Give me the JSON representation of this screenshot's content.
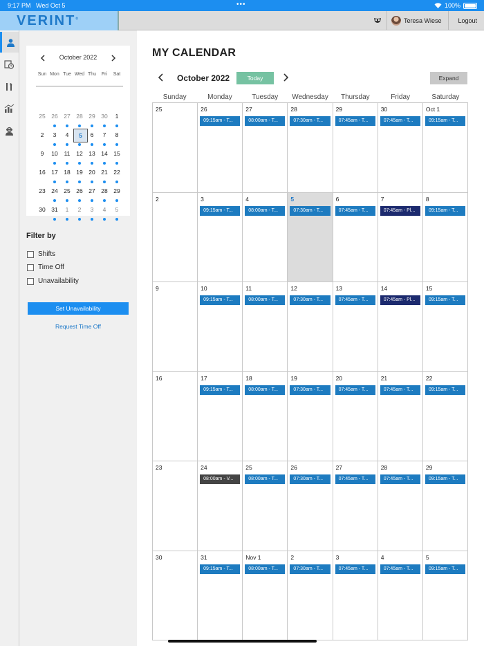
{
  "status_bar": {
    "time": "9:17 PM",
    "date": "Wed Oct 5",
    "dots": "•••",
    "battery": "100%"
  },
  "header": {
    "logo": "VERINT",
    "user_name": "Teresa Wiese",
    "logout_label": "Logout"
  },
  "rail": {
    "items": [
      "person-icon",
      "time-history-icon",
      "tools-icon",
      "reports-icon",
      "agent-icon"
    ]
  },
  "mini_calendar": {
    "month_label": "October 2022",
    "dows": [
      "Sun",
      "Mon",
      "Tue",
      "Wed",
      "Thu",
      "Fri",
      "Sat"
    ],
    "weeks": [
      [
        {
          "d": "25",
          "o": true,
          "dot": false
        },
        {
          "d": "26",
          "o": true,
          "dot": true
        },
        {
          "d": "27",
          "o": true,
          "dot": true
        },
        {
          "d": "28",
          "o": true,
          "dot": true
        },
        {
          "d": "29",
          "o": true,
          "dot": true
        },
        {
          "d": "30",
          "o": true,
          "dot": true
        },
        {
          "d": "1",
          "o": false,
          "dot": true
        }
      ],
      [
        {
          "d": "2",
          "o": false,
          "dot": false
        },
        {
          "d": "3",
          "o": false,
          "dot": true
        },
        {
          "d": "4",
          "o": false,
          "dot": true
        },
        {
          "d": "5",
          "o": false,
          "dot": true,
          "sel": true
        },
        {
          "d": "6",
          "o": false,
          "dot": true
        },
        {
          "d": "7",
          "o": false,
          "dot": true
        },
        {
          "d": "8",
          "o": false,
          "dot": true
        }
      ],
      [
        {
          "d": "9",
          "o": false,
          "dot": false
        },
        {
          "d": "10",
          "o": false,
          "dot": true
        },
        {
          "d": "11",
          "o": false,
          "dot": true
        },
        {
          "d": "12",
          "o": false,
          "dot": true
        },
        {
          "d": "13",
          "o": false,
          "dot": true
        },
        {
          "d": "14",
          "o": false,
          "dot": true
        },
        {
          "d": "15",
          "o": false,
          "dot": true
        }
      ],
      [
        {
          "d": "16",
          "o": false,
          "dot": false
        },
        {
          "d": "17",
          "o": false,
          "dot": true
        },
        {
          "d": "18",
          "o": false,
          "dot": true
        },
        {
          "d": "19",
          "o": false,
          "dot": true
        },
        {
          "d": "20",
          "o": false,
          "dot": true
        },
        {
          "d": "21",
          "o": false,
          "dot": true
        },
        {
          "d": "22",
          "o": false,
          "dot": true
        }
      ],
      [
        {
          "d": "23",
          "o": false,
          "dot": false
        },
        {
          "d": "24",
          "o": false,
          "dot": true
        },
        {
          "d": "25",
          "o": false,
          "dot": true
        },
        {
          "d": "26",
          "o": false,
          "dot": true
        },
        {
          "d": "27",
          "o": false,
          "dot": true
        },
        {
          "d": "28",
          "o": false,
          "dot": true
        },
        {
          "d": "29",
          "o": false,
          "dot": true
        }
      ],
      [
        {
          "d": "30",
          "o": false,
          "dot": false
        },
        {
          "d": "31",
          "o": false,
          "dot": true
        },
        {
          "d": "1",
          "o": true,
          "dot": true
        },
        {
          "d": "2",
          "o": true,
          "dot": true
        },
        {
          "d": "3",
          "o": true,
          "dot": true
        },
        {
          "d": "4",
          "o": true,
          "dot": true
        },
        {
          "d": "5",
          "o": true,
          "dot": true
        }
      ]
    ]
  },
  "filter": {
    "title": "Filter by",
    "options": [
      {
        "label": "Shifts",
        "checked": false
      },
      {
        "label": "Time Off",
        "checked": false
      },
      {
        "label": "Unavailability",
        "checked": false
      }
    ],
    "set_unavailability_label": "Set Unavailability",
    "request_time_off_label": "Request Time Off"
  },
  "calendar": {
    "title": "MY CALENDAR",
    "month_label": "October 2022",
    "today_label": "Today",
    "expand_label": "Expand",
    "dows": [
      "Sunday",
      "Monday",
      "Tuesday",
      "Wednesday",
      "Thursday",
      "Friday",
      "Saturday"
    ],
    "weeks": [
      [
        {
          "d": "25"
        },
        {
          "d": "26",
          "e": "09:15am - T...",
          "t": "shift"
        },
        {
          "d": "27",
          "e": "08:00am - T...",
          "t": "shift"
        },
        {
          "d": "28",
          "e": "07:30am - T...",
          "t": "shift"
        },
        {
          "d": "29",
          "e": "07:45am - T...",
          "t": "shift"
        },
        {
          "d": "30",
          "e": "07:45am - T...",
          "t": "shift"
        },
        {
          "d": "Oct 1",
          "e": "09:15am - T...",
          "t": "shift"
        }
      ],
      [
        {
          "d": "2"
        },
        {
          "d": "3",
          "e": "09:15am - T...",
          "t": "shift"
        },
        {
          "d": "4",
          "e": "08:00am - T...",
          "t": "shift"
        },
        {
          "d": "5",
          "e": "07:30am - T...",
          "t": "shift",
          "today": true
        },
        {
          "d": "6",
          "e": "07:45am - T...",
          "t": "shift"
        },
        {
          "d": "7",
          "e": "07:45am - Pl...",
          "t": "planned"
        },
        {
          "d": "8",
          "e": "09:15am - T...",
          "t": "shift"
        }
      ],
      [
        {
          "d": "9"
        },
        {
          "d": "10",
          "e": "09:15am - T...",
          "t": "shift"
        },
        {
          "d": "11",
          "e": "08:00am - T...",
          "t": "shift"
        },
        {
          "d": "12",
          "e": "07:30am - T...",
          "t": "shift"
        },
        {
          "d": "13",
          "e": "07:45am - T...",
          "t": "shift"
        },
        {
          "d": "14",
          "e": "07:45am - Pl...",
          "t": "planned"
        },
        {
          "d": "15",
          "e": "09:15am - T...",
          "t": "shift"
        }
      ],
      [
        {
          "d": "16"
        },
        {
          "d": "17",
          "e": "09:15am - T...",
          "t": "shift"
        },
        {
          "d": "18",
          "e": "08:00am - T...",
          "t": "shift"
        },
        {
          "d": "19",
          "e": "07:30am - T...",
          "t": "shift"
        },
        {
          "d": "20",
          "e": "07:45am - T...",
          "t": "shift"
        },
        {
          "d": "21",
          "e": "07:45am - T...",
          "t": "shift"
        },
        {
          "d": "22",
          "e": "09:15am - T...",
          "t": "shift"
        }
      ],
      [
        {
          "d": "23"
        },
        {
          "d": "24",
          "e": "08:00am - V...",
          "t": "vac"
        },
        {
          "d": "25",
          "e": "08:00am - T...",
          "t": "shift"
        },
        {
          "d": "26",
          "e": "07:30am - T...",
          "t": "shift"
        },
        {
          "d": "27",
          "e": "07:45am - T...",
          "t": "shift"
        },
        {
          "d": "28",
          "e": "07:45am - T...",
          "t": "shift"
        },
        {
          "d": "29",
          "e": "09:15am - T...",
          "t": "shift"
        }
      ],
      [
        {
          "d": "30"
        },
        {
          "d": "31",
          "e": "09:15am - T...",
          "t": "shift"
        },
        {
          "d": "Nov 1",
          "e": "08:00am - T...",
          "t": "shift"
        },
        {
          "d": "2",
          "e": "07:30am - T...",
          "t": "shift"
        },
        {
          "d": "3",
          "e": "07:45am - T...",
          "t": "shift"
        },
        {
          "d": "4",
          "e": "07:45am - T...",
          "t": "shift"
        },
        {
          "d": "5",
          "e": "09:15am - T...",
          "t": "shift"
        }
      ]
    ]
  },
  "colors": {
    "accent": "#1c8ef0",
    "shift": "#1d7bc0",
    "planned": "#1c2a6e",
    "vacation": "#444444",
    "today_button": "#76c2a2"
  }
}
